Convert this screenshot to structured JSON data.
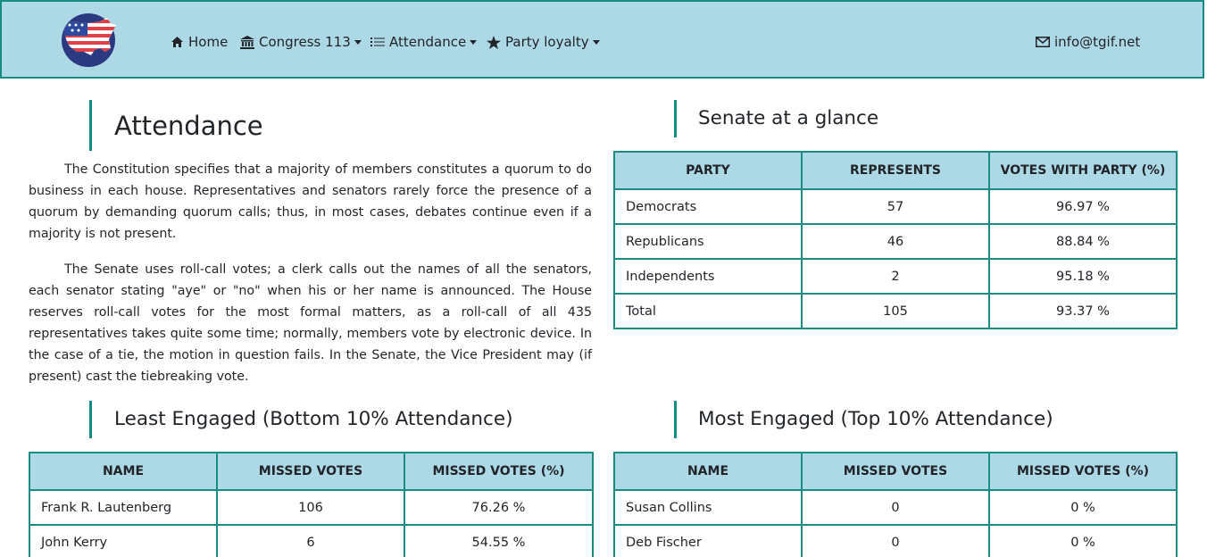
{
  "nav": {
    "home": "Home",
    "congress": "Congress 113",
    "attendance": "Attendance",
    "party_loyalty": "Party loyalty",
    "email": "info@tgif.net"
  },
  "attendance": {
    "title": "Attendance",
    "para1": "The Constitution specifies that a majority of members constitutes a quorum to do business in each house. Representatives and senators rarely force the presence of a quorum by demanding quorum calls; thus, in most cases, debates continue even if a majority is not present.",
    "para2": "The Senate uses roll-call votes; a clerk calls out the names of all the senators, each senator stating \"aye\" or \"no\" when his or her name is announced. The House reserves roll-call votes for the most formal matters, as a roll-call of all 435 representatives takes quite some time; normally, members vote by electronic device. In the case of a tie, the motion in question fails. In the Senate, the Vice President may (if present) cast the tiebreaking vote."
  },
  "glance": {
    "title": "Senate at a glance",
    "headers": [
      "PARTY",
      "REPRESENTS",
      "VOTES WITH PARTY (%)"
    ],
    "rows": [
      [
        "Democrats",
        "57",
        "96.97 %"
      ],
      [
        "Republicans",
        "46",
        "88.84 %"
      ],
      [
        "Independents",
        "2",
        "95.18 %"
      ],
      [
        "Total",
        "105",
        "93.37 %"
      ]
    ]
  },
  "least": {
    "title": "Least Engaged (Bottom 10% Attendance)",
    "headers": [
      "NAME",
      "MISSED VOTES",
      "MISSED VOTES (%)"
    ],
    "rows": [
      [
        "Frank R. Lautenberg",
        "106",
        "76.26 %"
      ],
      [
        "John Kerry",
        "6",
        "54.55 %"
      ]
    ]
  },
  "most": {
    "title": "Most Engaged (Top 10% Attendance)",
    "headers": [
      "NAME",
      "MISSED VOTES",
      "MISSED VOTES (%)"
    ],
    "rows": [
      [
        "Susan Collins",
        "0",
        "0 %"
      ],
      [
        "Deb Fischer",
        "0",
        "0 %"
      ]
    ]
  },
  "colors": {
    "navbar_bg": "#add8e6",
    "accent_border": "#1a8a85",
    "table_header_bg": "#add8e6"
  }
}
